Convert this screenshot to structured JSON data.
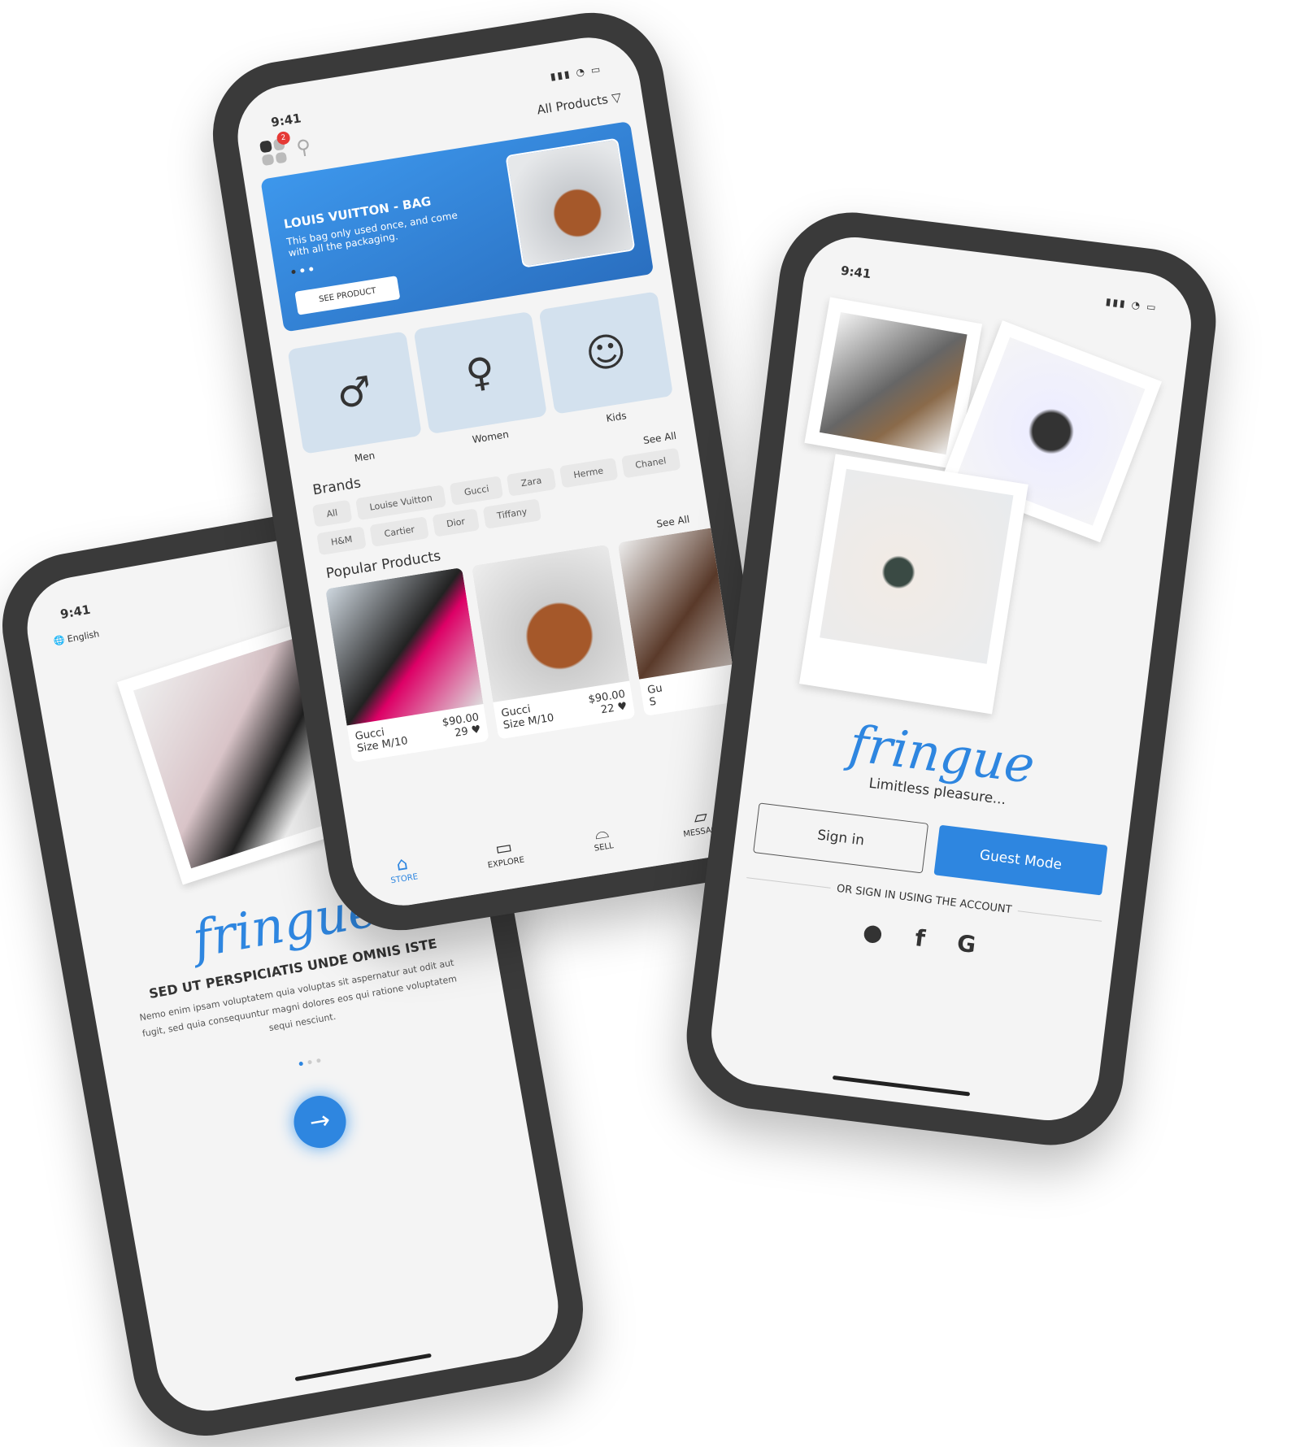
{
  "store": {
    "time": "9:41",
    "filter": "All Products",
    "badge": "2",
    "banner": {
      "title": "LOUIS VUITTON - BAG",
      "desc": "This bag only used once, and come with all the packaging.",
      "button": "SEE PRODUCT"
    },
    "categories": [
      {
        "label": "Men",
        "icon": "♂"
      },
      {
        "label": "Women",
        "icon": "♀"
      },
      {
        "label": "Kids",
        "icon": "☺"
      }
    ],
    "see_all": "See All",
    "brands_title": "Brands",
    "brands": [
      "All",
      "Louise Vuitton",
      "Gucci",
      "Zara",
      "Herme",
      "Chanel",
      "H&M",
      "Cartier",
      "Dior",
      "Tiffany"
    ],
    "popular_title": "Popular Products",
    "products": [
      {
        "brand": "Gucci",
        "size": "Size M/10",
        "price": "$90.00",
        "likes": "29 ♥"
      },
      {
        "brand": "Gucci",
        "size": "Size M/10",
        "price": "$90.00",
        "likes": "22 ♥"
      },
      {
        "brand": "Gu",
        "size": "S",
        "price": "",
        "likes": ""
      }
    ],
    "nav": [
      "STORE",
      "EXPLORE",
      "SELL",
      "MESSAGE"
    ]
  },
  "onboarding": {
    "time": "9:41",
    "language": "English",
    "logo": "fringue",
    "headline": "SED UT PERSPICIATIS UNDE OMNIS ISTE",
    "body": "Nemo enim ipsam voluptatem quia voluptas sit aspernatur aut odit aut fugit, sed quia consequuntur magni dolores eos qui ratione voluptatem sequi nesciunt.",
    "next": "→"
  },
  "login": {
    "time": "9:41",
    "logo": "fringue",
    "tagline": "Limitless pleasure...",
    "sign_in": "Sign in",
    "guest": "Guest Mode",
    "or": "OR SIGN IN USING THE ACCOUNT",
    "social": [
      "",
      "f",
      "G"
    ]
  },
  "colors": {
    "accent": "#2e86e0"
  }
}
